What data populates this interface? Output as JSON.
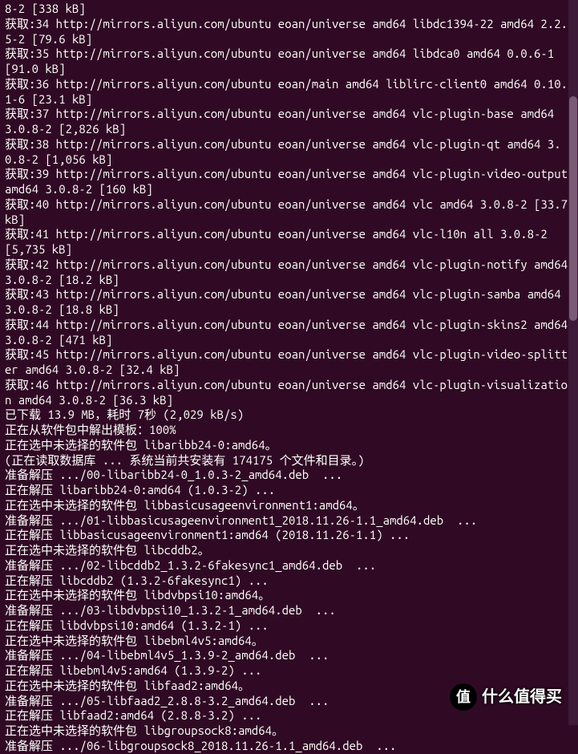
{
  "terminal": {
    "lines": [
      "8-2 [338 kB]",
      "获取:34 http://mirrors.aliyun.com/ubuntu eoan/universe amd64 libdc1394-22 amd64 2.2.5-2 [79.6 kB]",
      "获取:35 http://mirrors.aliyun.com/ubuntu eoan/universe amd64 libdca0 amd64 0.0.6-1 [91.0 kB]",
      "获取:36 http://mirrors.aliyun.com/ubuntu eoan/main amd64 liblirc-client0 amd64 0.10.1-6 [23.1 kB]",
      "获取:37 http://mirrors.aliyun.com/ubuntu eoan/universe amd64 vlc-plugin-base amd64 3.0.8-2 [2,826 kB]",
      "获取:38 http://mirrors.aliyun.com/ubuntu eoan/universe amd64 vlc-plugin-qt amd64 3.0.8-2 [1,056 kB]",
      "获取:39 http://mirrors.aliyun.com/ubuntu eoan/universe amd64 vlc-plugin-video-output amd64 3.0.8-2 [160 kB]",
      "获取:40 http://mirrors.aliyun.com/ubuntu eoan/universe amd64 vlc amd64 3.0.8-2 [33.7 kB]",
      "获取:41 http://mirrors.aliyun.com/ubuntu eoan/universe amd64 vlc-l10n all 3.0.8-2 [5,735 kB]",
      "获取:42 http://mirrors.aliyun.com/ubuntu eoan/universe amd64 vlc-plugin-notify amd64 3.0.8-2 [18.2 kB]",
      "获取:43 http://mirrors.aliyun.com/ubuntu eoan/universe amd64 vlc-plugin-samba amd64 3.0.8-2 [18.8 kB]",
      "获取:44 http://mirrors.aliyun.com/ubuntu eoan/universe amd64 vlc-plugin-skins2 amd64 3.0.8-2 [471 kB]",
      "获取:45 http://mirrors.aliyun.com/ubuntu eoan/universe amd64 vlc-plugin-video-splitter amd64 3.0.8-2 [32.4 kB]",
      "获取:46 http://mirrors.aliyun.com/ubuntu eoan/universe amd64 vlc-plugin-visualization amd64 3.0.8-2 [36.3 kB]",
      "已下载 13.9 MB，耗时 7秒 (2,029 kB/s)",
      "正在从软件包中解出模板：100%",
      "正在选中未选择的软件包 libaribb24-0:amd64。",
      "(正在读取数据库 ... 系统当前共安装有 174175 个文件和目录。)",
      "准备解压 .../00-libaribb24-0_1.0.3-2_amd64.deb  ...",
      "正在解压 libaribb24-0:amd64 (1.0.3-2) ...",
      "正在选中未选择的软件包 libbasicusageenvironment1:amd64。",
      "准备解压 .../01-libbasicusageenvironment1_2018.11.26-1.1_amd64.deb  ...",
      "正在解压 libbasicusageenvironment1:amd64 (2018.11.26-1.1) ...",
      "正在选中未选择的软件包 libcddb2。",
      "准备解压 .../02-libcddb2_1.3.2-6fakesync1_amd64.deb  ...",
      "正在解压 libcddb2 (1.3.2-6fakesync1) ...",
      "正在选中未选择的软件包 libdvbpsi10:amd64。",
      "准备解压 .../03-libdvbpsi10_1.3.2-1_amd64.deb  ...",
      "正在解压 libdvbpsi10:amd64 (1.3.2-1) ...",
      "正在选中未选择的软件包 libebml4v5:amd64。",
      "准备解压 .../04-libebml4v5_1.3.9-2_amd64.deb  ...",
      "正在解压 libebml4v5:amd64 (1.3.9-2) ...",
      "正在选中未选择的软件包 libfaad2:amd64。",
      "准备解压 .../05-libfaad2_2.8.8-3.2_amd64.deb  ...",
      "正在解压 libfaad2:amd64 (2.8.8-3.2) ...",
      "正在选中未选择的软件包 libgroupsock8:amd64。",
      "准备解压 .../06-libgroupsock8_2018.11.26-1.1_amd64.deb  ..."
    ]
  },
  "watermark": {
    "badge": "值",
    "text": "什么值得买"
  }
}
